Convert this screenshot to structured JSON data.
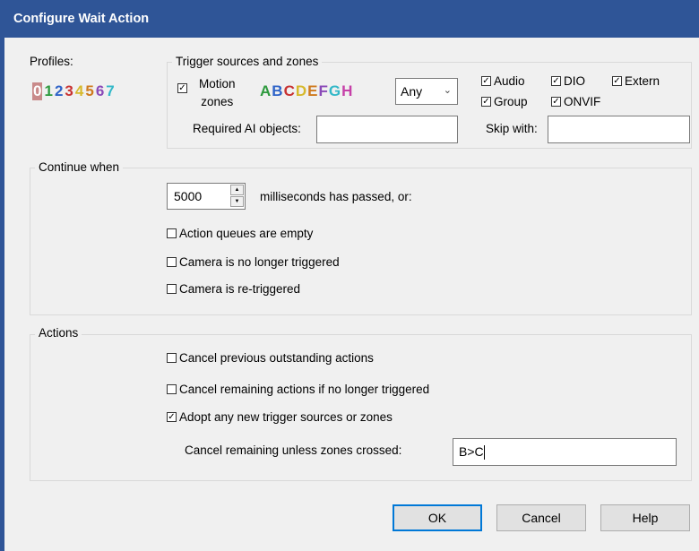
{
  "window": {
    "title": "Configure Wait Action"
  },
  "profiles": {
    "label": "Profiles:",
    "items": [
      {
        "text": "0",
        "color": "#c98a8a",
        "selected": true
      },
      {
        "text": "1",
        "color": "#2e9a3e"
      },
      {
        "text": "2",
        "color": "#2f64c8"
      },
      {
        "text": "3",
        "color": "#c83232"
      },
      {
        "text": "4",
        "color": "#d6b92c"
      },
      {
        "text": "5",
        "color": "#cf7a1e"
      },
      {
        "text": "6",
        "color": "#8a4ab8"
      },
      {
        "text": "7",
        "color": "#33b8c8"
      }
    ]
  },
  "trigger": {
    "title": "Trigger sources and zones",
    "motion_label_line1": "Motion",
    "motion_label_line2": "zones",
    "zones": [
      {
        "text": "A",
        "color": "#2e9a3e"
      },
      {
        "text": "B",
        "color": "#2f64c8"
      },
      {
        "text": "C",
        "color": "#c83232"
      },
      {
        "text": "D",
        "color": "#d6b92c"
      },
      {
        "text": "E",
        "color": "#cf7a1e"
      },
      {
        "text": "F",
        "color": "#8a4ab8"
      },
      {
        "text": "G",
        "color": "#33b8c8"
      },
      {
        "text": "H",
        "color": "#c640a8"
      }
    ],
    "zone_mode": "Any",
    "audio": "Audio",
    "dio": "DIO",
    "extern": "Extern",
    "group": "Group",
    "onvif": "ONVIF",
    "ai_label": "Required AI objects:",
    "ai_value": "",
    "skip_label": "Skip with:",
    "skip_value": ""
  },
  "continue_when": {
    "title": "Continue when",
    "ms_value": "5000",
    "ms_label": "milliseconds has passed, or:",
    "queues_empty": "Action queues are empty",
    "no_longer_triggered": "Camera is no longer triggered",
    "re_triggered": "Camera is re-triggered"
  },
  "actions": {
    "title": "Actions",
    "cancel_previous": "Cancel previous outstanding actions",
    "cancel_remaining": "Cancel remaining actions if no longer triggered",
    "adopt": "Adopt any new trigger sources or zones",
    "zones_crossed_label": "Cancel remaining unless zones crossed:",
    "zones_crossed_value": "B>C"
  },
  "buttons": {
    "ok": "OK",
    "cancel": "Cancel",
    "help": "Help"
  }
}
